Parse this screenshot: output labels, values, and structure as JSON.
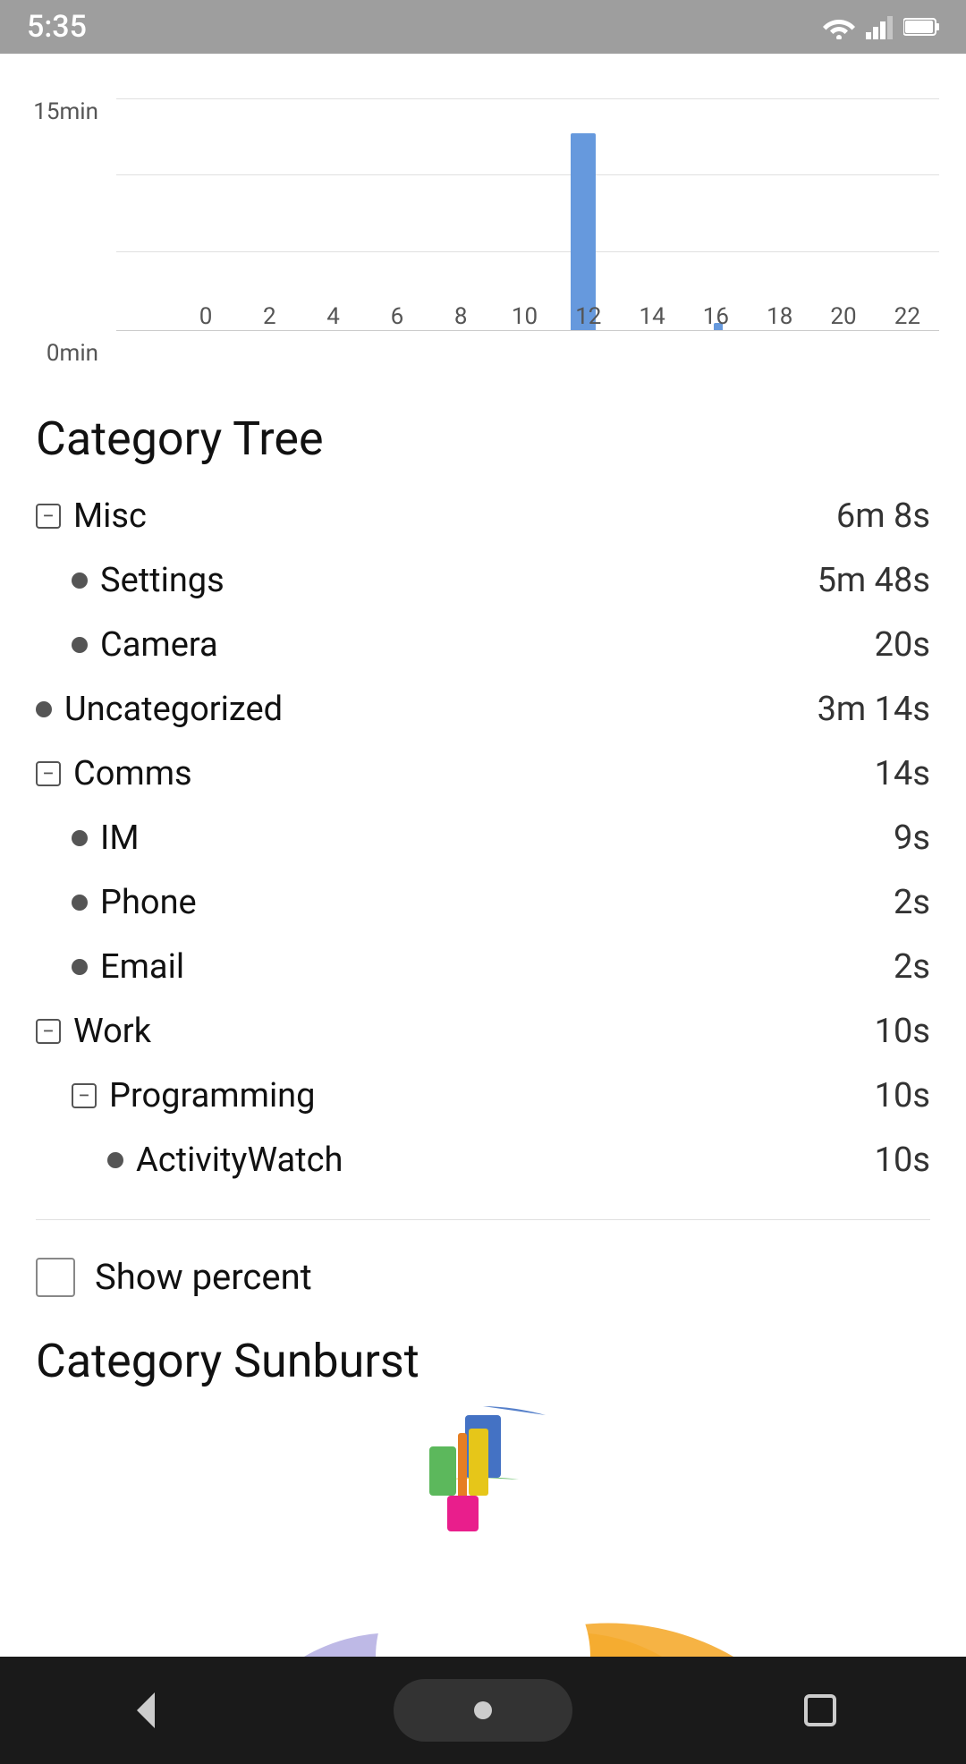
{
  "statusBar": {
    "time": "5:35"
  },
  "chart": {
    "yLabels": [
      "15min",
      "0min"
    ],
    "xLabels": [
      "0",
      "2",
      "4",
      "6",
      "8",
      "10",
      "12",
      "14",
      "16",
      "18",
      "20",
      "22"
    ],
    "bars": [
      {
        "index": 13,
        "heightPercent": 85
      },
      {
        "index": 17,
        "heightPercent": 3
      }
    ]
  },
  "categoryTree": {
    "title": "Category Tree",
    "items": [
      {
        "level": 0,
        "type": "collapse",
        "label": "Misc",
        "value": "6m 8s"
      },
      {
        "level": 1,
        "type": "bullet",
        "label": "Settings",
        "value": "5m 48s"
      },
      {
        "level": 1,
        "type": "bullet",
        "label": "Camera",
        "value": "20s"
      },
      {
        "level": 0,
        "type": "bullet",
        "label": "Uncategorized",
        "value": "3m 14s"
      },
      {
        "level": 0,
        "type": "collapse",
        "label": "Comms",
        "value": "14s"
      },
      {
        "level": 1,
        "type": "bullet",
        "label": "IM",
        "value": "9s"
      },
      {
        "level": 1,
        "type": "bullet",
        "label": "Phone",
        "value": "2s"
      },
      {
        "level": 1,
        "type": "bullet",
        "label": "Email",
        "value": "2s"
      },
      {
        "level": 0,
        "type": "collapse",
        "label": "Work",
        "value": "10s"
      },
      {
        "level": 1,
        "type": "collapse",
        "label": "Programming",
        "value": "10s"
      },
      {
        "level": 2,
        "type": "bullet",
        "label": "ActivityWatch",
        "value": "10s"
      }
    ]
  },
  "showPercent": {
    "label": "Show percent",
    "checked": false
  },
  "sunburst": {
    "title": "Category Sunburst"
  }
}
